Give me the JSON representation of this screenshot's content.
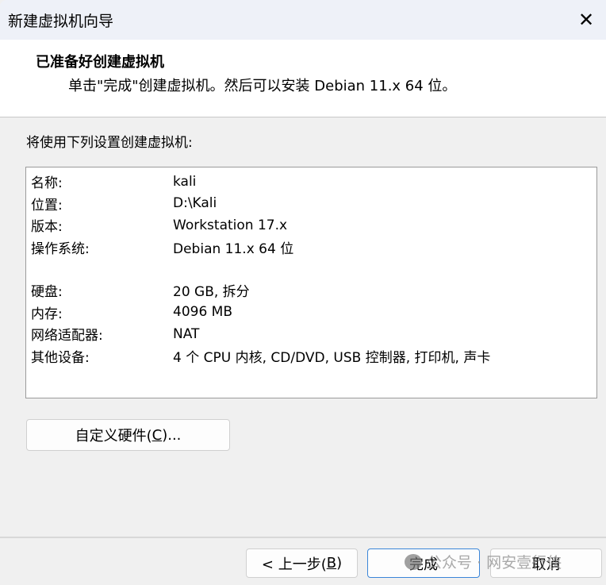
{
  "window": {
    "title": "新建虚拟机向导",
    "close_icon": "close-icon"
  },
  "header": {
    "title": "已准备好创建虚拟机",
    "subtitle": "单击\"完成\"创建虚拟机。然后可以安装 Debian 11.x 64 位。"
  },
  "intro": "将使用下列设置创建虚拟机:",
  "settings_group1": [
    {
      "key": "名称:",
      "value": "kali"
    },
    {
      "key": "位置:",
      "value": "D:\\Kali"
    },
    {
      "key": "版本:",
      "value": "Workstation 17.x"
    },
    {
      "key": "操作系统:",
      "value": "Debian 11.x 64 位"
    }
  ],
  "settings_group2": [
    {
      "key": "硬盘:",
      "value": "20 GB, 拆分"
    },
    {
      "key": "内存:",
      "value": "4096 MB"
    },
    {
      "key": "网络适配器:",
      "value": "NAT"
    },
    {
      "key": "其他设备:",
      "value": "4 个 CPU 内核, CD/DVD, USB 控制器, 打印机, 声卡"
    }
  ],
  "buttons": {
    "customize_pre": "自定义硬件(",
    "customize_key": "C",
    "customize_post": ")...",
    "back_pre": "< 上一步(",
    "back_key": "B",
    "back_post": ")",
    "finish": "完成",
    "cancel": "取消"
  },
  "watermark": "公众号 · 网安壹行侠"
}
